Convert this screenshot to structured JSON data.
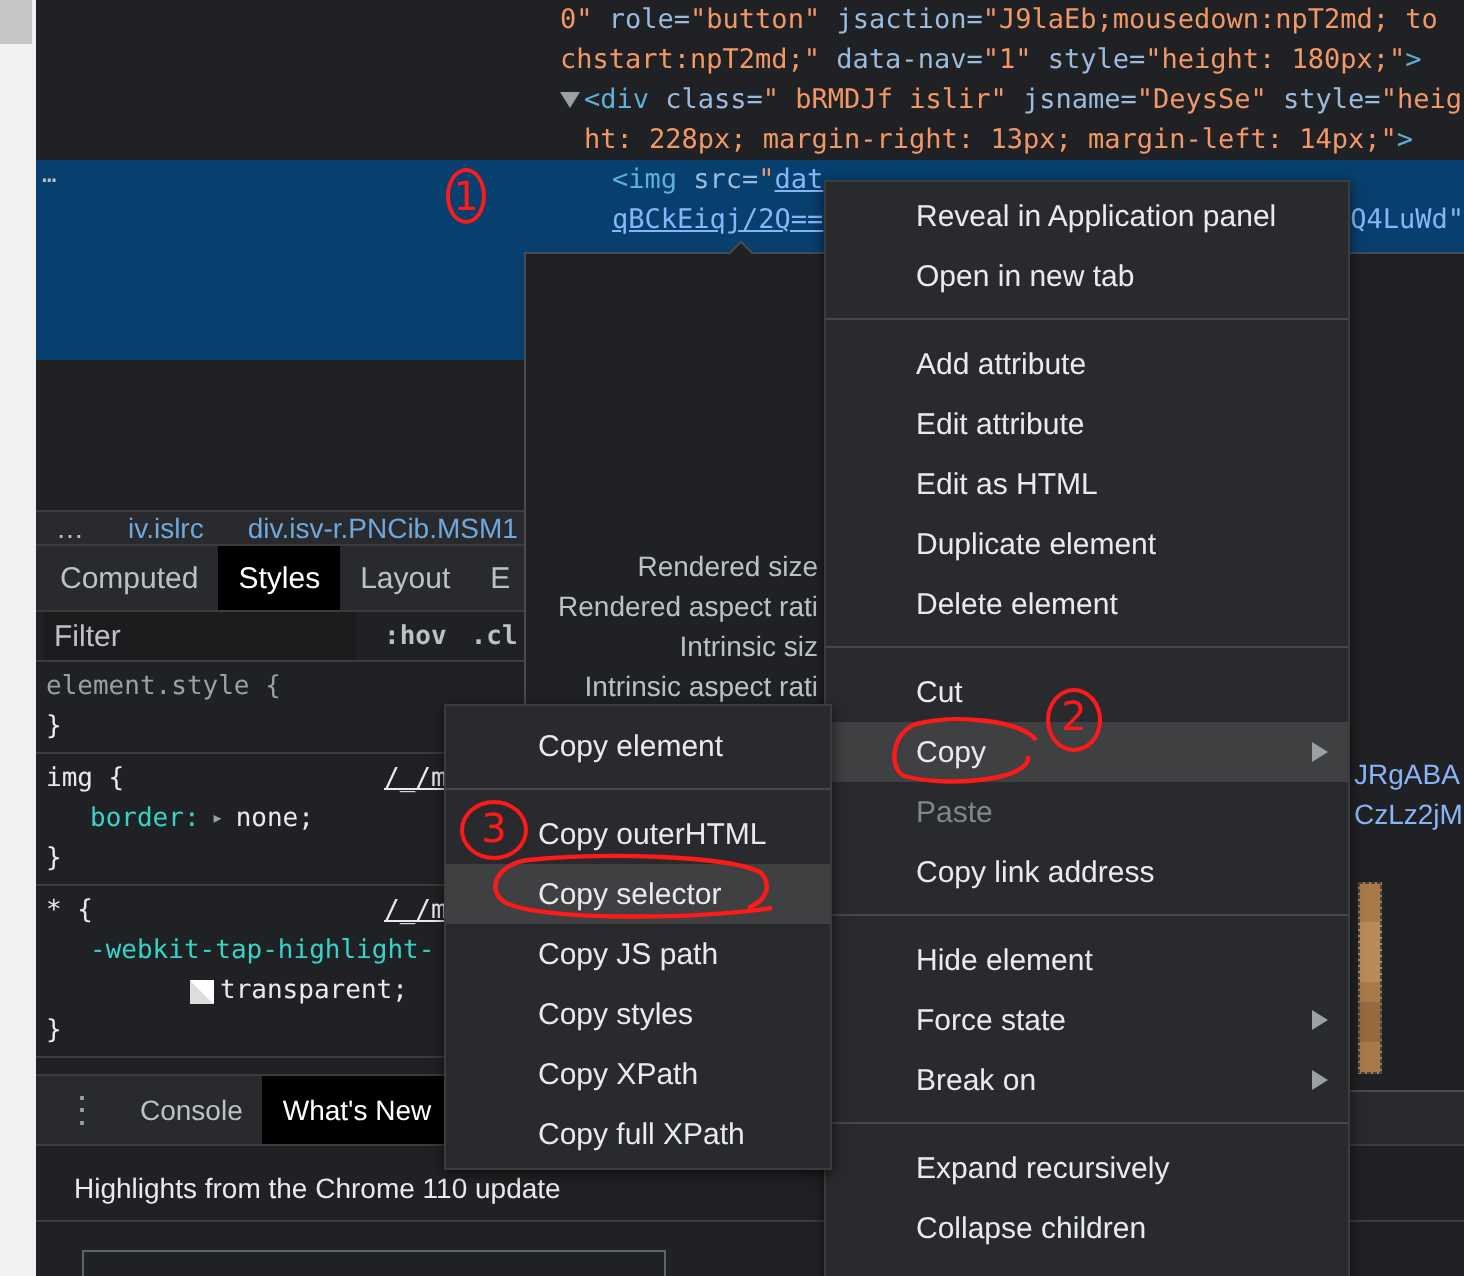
{
  "elements": {
    "lines": [
      {
        "kind": "wrap",
        "segments": [
          {
            "kind": "value",
            "text": "0\""
          },
          {
            "kind": "attr",
            "text": " role="
          },
          {
            "kind": "value",
            "text": "\"button\""
          },
          {
            "kind": "attr",
            "text": " jsaction="
          },
          {
            "kind": "value",
            "text": "\"J9laEb;mousedown:npT2md; to"
          }
        ]
      },
      {
        "kind": "wrap",
        "segments": [
          {
            "kind": "value",
            "text": "chstart:npT2md;\""
          },
          {
            "kind": "attr",
            "text": " data-nav="
          },
          {
            "kind": "value",
            "text": "\"1\""
          },
          {
            "kind": "attr",
            "text": " style="
          },
          {
            "kind": "value",
            "text": "\"height: 180px;\""
          },
          {
            "kind": "tag",
            "text": ">"
          }
        ]
      },
      {
        "kind": "node",
        "expanded": true,
        "segments": [
          {
            "kind": "tag",
            "text": "<div"
          },
          {
            "kind": "attr",
            "text": " class="
          },
          {
            "kind": "value",
            "text": "\" bRMDJf islir\""
          },
          {
            "kind": "attr",
            "text": " jsname="
          },
          {
            "kind": "value",
            "text": "\"DeysSe\""
          },
          {
            "kind": "attr",
            "text": " style="
          },
          {
            "kind": "value",
            "text": "\"heig"
          }
        ]
      },
      {
        "kind": "node-wrap",
        "segments": [
          {
            "kind": "value",
            "text": "ht: 228px; margin-right: 13px; margin-left: 14px;\""
          },
          {
            "kind": "tag",
            "text": ">"
          }
        ]
      }
    ],
    "selected_node": {
      "more": "…",
      "lines": [
        {
          "segments": [
            {
              "kind": "tag",
              "text": "<img"
            },
            {
              "kind": "attr",
              "text": " src="
            },
            {
              "kind": "value",
              "text": "\""
            },
            {
              "kind": "link",
              "text": "dat"
            }
          ]
        },
        {
          "segments": [
            {
              "kind": "link",
              "text": "qBCkEiqj/2Q=="
            },
            {
              "kind": "far",
              "text": "Q4LuWd\""
            }
          ]
        }
      ]
    }
  },
  "breadcrumbs": {
    "more": "…",
    "items": [
      "iv.islrc",
      "div.isv-r.PNCib.MSM1"
    ]
  },
  "tabs": [
    {
      "label": "Computed",
      "selected": false
    },
    {
      "label": "Styles",
      "selected": true
    },
    {
      "label": "Layout",
      "selected": false
    },
    {
      "label": "E",
      "selected": false
    }
  ],
  "filter": {
    "placeholder": "Filter",
    "hov": ":hov",
    "cls": ".cl"
  },
  "rules": [
    {
      "selector": "element.style",
      "kind": "inline",
      "open": "{",
      "close": "}"
    },
    {
      "selector": "img",
      "kind": "rule",
      "source": "/_/m",
      "open": "{",
      "close": "}",
      "declarations": [
        {
          "property": "border:",
          "expander": "▸",
          "value": "none;"
        }
      ]
    },
    {
      "selector": "*",
      "kind": "rule",
      "source": "/_/m",
      "open": "{",
      "close": "}",
      "declarations": [
        {
          "property": "-webkit-tap-highlight-",
          "swatch": true,
          "value": "transparent;"
        }
      ]
    }
  ],
  "drawer": {
    "menu": "⋮",
    "tabs": [
      {
        "label": "Console",
        "selected": false
      },
      {
        "label": "What's New",
        "selected": true
      }
    ],
    "headline": "Highlights from the Chrome 110 update"
  },
  "tooltip": {
    "labels": [
      "Rendered size",
      "Rendered aspect rati",
      "Intrinsic siz",
      "Intrinsic aspect rati"
    ],
    "src_lines": [
      "JRgABA",
      "CzLz2jM"
    ],
    "preview": {
      "kind": "picture"
    }
  },
  "context_menu": {
    "items": [
      {
        "kind": "item",
        "label": "Reveal in Application panel",
        "selected": false,
        "disabled": false,
        "submenu": false
      },
      {
        "kind": "item",
        "label": "Open in new tab",
        "selected": false,
        "disabled": false,
        "submenu": false
      },
      {
        "kind": "separator"
      },
      {
        "kind": "item",
        "label": "Add attribute",
        "selected": false,
        "disabled": false,
        "submenu": false
      },
      {
        "kind": "item",
        "label": "Edit attribute",
        "selected": false,
        "disabled": false,
        "submenu": false
      },
      {
        "kind": "item",
        "label": "Edit as HTML",
        "selected": false,
        "disabled": false,
        "submenu": false
      },
      {
        "kind": "item",
        "label": "Duplicate element",
        "selected": false,
        "disabled": false,
        "submenu": false
      },
      {
        "kind": "item",
        "label": "Delete element",
        "selected": false,
        "disabled": false,
        "submenu": false
      },
      {
        "kind": "separator"
      },
      {
        "kind": "item",
        "label": "Cut",
        "selected": false,
        "disabled": false,
        "submenu": false
      },
      {
        "kind": "item",
        "label": "Copy",
        "selected": true,
        "disabled": false,
        "submenu": true
      },
      {
        "kind": "item",
        "label": "Paste",
        "selected": false,
        "disabled": true,
        "submenu": false
      },
      {
        "kind": "item",
        "label": "Copy link address",
        "selected": false,
        "disabled": false,
        "submenu": false
      },
      {
        "kind": "separator"
      },
      {
        "kind": "item",
        "label": "Hide element",
        "selected": false,
        "disabled": false,
        "submenu": false
      },
      {
        "kind": "item",
        "label": "Force state",
        "selected": false,
        "disabled": false,
        "submenu": true
      },
      {
        "kind": "item",
        "label": "Break on",
        "selected": false,
        "disabled": false,
        "submenu": true
      },
      {
        "kind": "separator"
      },
      {
        "kind": "item",
        "label": "Expand recursively",
        "selected": false,
        "disabled": false,
        "submenu": false
      },
      {
        "kind": "item",
        "label": "Collapse children",
        "selected": false,
        "disabled": false,
        "submenu": false
      }
    ]
  },
  "copy_submenu": {
    "items": [
      {
        "kind": "item",
        "label": "Copy element",
        "selected": false
      },
      {
        "kind": "separator"
      },
      {
        "kind": "item",
        "label": "Copy outerHTML",
        "selected": false
      },
      {
        "kind": "item",
        "label": "Copy selector",
        "selected": true
      },
      {
        "kind": "item",
        "label": "Copy JS path",
        "selected": false
      },
      {
        "kind": "item",
        "label": "Copy styles",
        "selected": false
      },
      {
        "kind": "item",
        "label": "Copy XPath",
        "selected": false
      },
      {
        "kind": "item",
        "label": "Copy full XPath",
        "selected": false
      }
    ]
  },
  "annotations": [
    {
      "label": "1"
    },
    {
      "label": "2"
    },
    {
      "label": "3"
    }
  ]
}
